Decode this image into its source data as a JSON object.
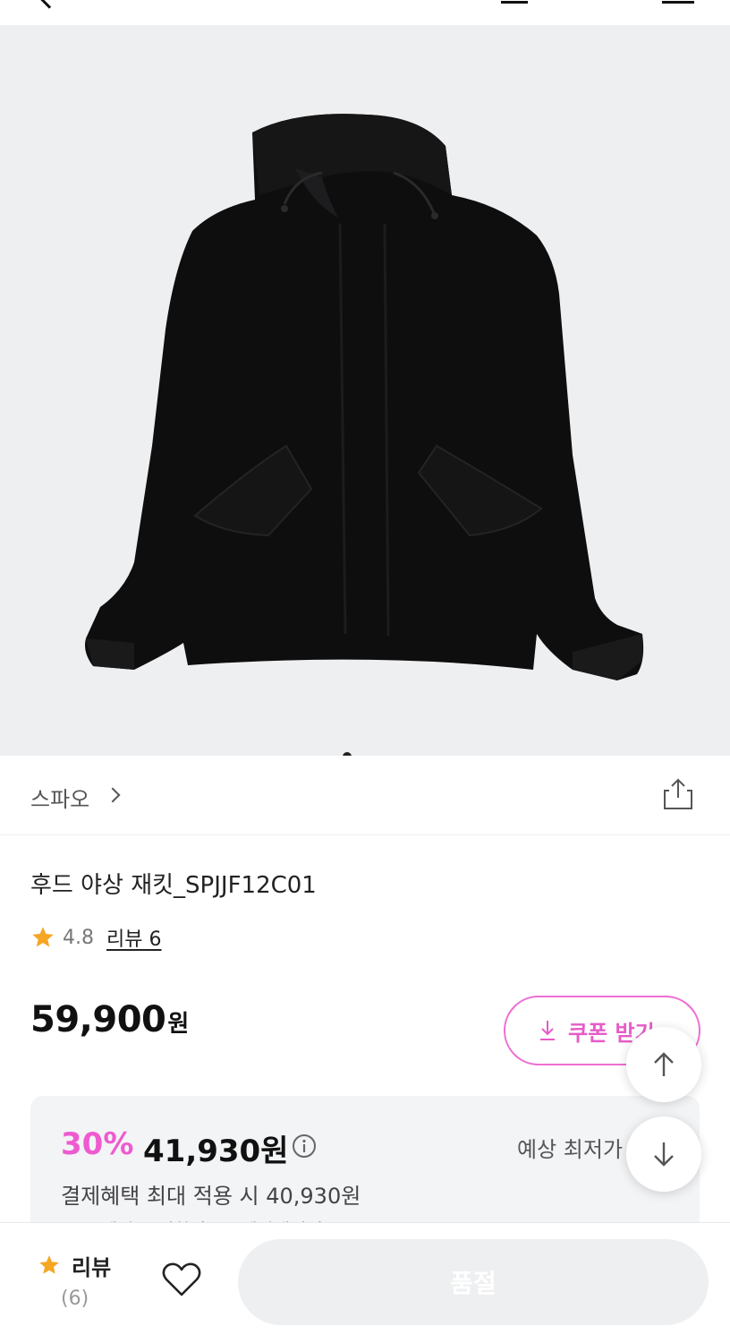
{
  "topbar": {
    "back_icon": "chevron-left-icon",
    "icons": [
      "bag-icon",
      "heart-icon",
      "menu-icon"
    ]
  },
  "product_image": {
    "alt": "black hooded jacket",
    "slide_count": 1,
    "active_slide": 1
  },
  "brand": {
    "name": "스파오",
    "chevron_icon": "chevron-right-icon",
    "share_icon": "share-icon"
  },
  "product": {
    "title": "후드 야상 재킷_SPJJF12C01",
    "rating": "4.8",
    "review_link": "리뷰 6",
    "price": "59,900",
    "price_unit": "원"
  },
  "coupon": {
    "label": "쿠폰 받기",
    "icon": "download-icon",
    "color": "#e65bc8"
  },
  "discount": {
    "rate": "30%",
    "price": "41,930원",
    "label": "예상 최저가",
    "sub": "결제혜택 최대 적용 시 40,930원",
    "sub2": "(토스페이 X 신한카드 / 페이백적립)",
    "rate_color": "#ee5bd0"
  },
  "floating": {
    "up_icon": "arrow-up-icon",
    "down_icon": "arrow-down-icon"
  },
  "bottom": {
    "review_label": "리뷰",
    "review_count": "(6)",
    "wish_icon": "heart-icon",
    "action_label": "품절"
  }
}
